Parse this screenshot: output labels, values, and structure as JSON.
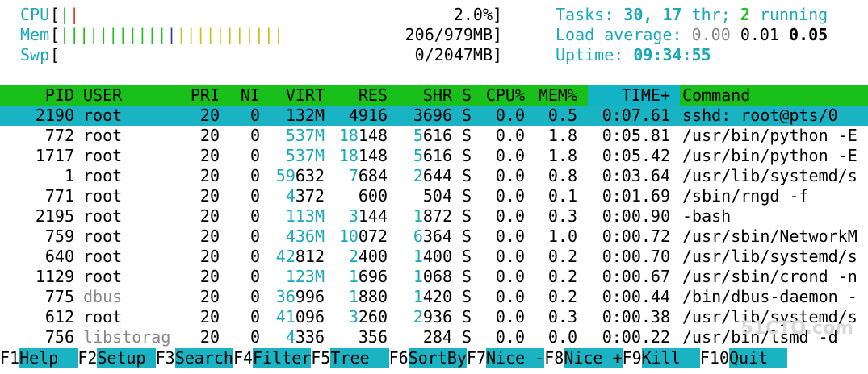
{
  "meters": {
    "cpu": {
      "label": "CPU",
      "value": "2.0%"
    },
    "mem": {
      "label": "Mem",
      "value": "206/979MB"
    },
    "swp": {
      "label": "Swp",
      "value": "0/2047MB"
    }
  },
  "summary": {
    "tasks_label": "Tasks:",
    "tasks_count": "30,",
    "threads": "17",
    "thr_label": "thr;",
    "running_count": "2",
    "running_label": "running",
    "load_label": "Load average:",
    "load1": "0.00",
    "load5": "0.01",
    "load15": "0.05",
    "uptime_label": "Uptime:",
    "uptime": "09:34:55"
  },
  "columns": {
    "pid": "PID",
    "user": "USER",
    "pri": "PRI",
    "ni": "NI",
    "virt": "VIRT",
    "res": "RES",
    "shr": "SHR",
    "s": "S",
    "cpu": "CPU%",
    "mem": "MEM%",
    "time": "TIME+",
    "command": "Command"
  },
  "processes": [
    {
      "pid": "2190",
      "user": "root",
      "pri": "20",
      "ni": "0",
      "virt": "132M",
      "res": "4916",
      "shr": "3696",
      "s": "S",
      "cpu": "0.0",
      "mem": "0.5",
      "time": "0:07.61",
      "command": "sshd: root@pts/0"
    },
    {
      "pid": "772",
      "user": "root",
      "pri": "20",
      "ni": "0",
      "virt": "537M",
      "res": "18148",
      "shr": "5616",
      "s": "S",
      "cpu": "0.0",
      "mem": "1.8",
      "time": "0:05.81",
      "command": "/usr/bin/python -E"
    },
    {
      "pid": "1717",
      "user": "root",
      "pri": "20",
      "ni": "0",
      "virt": "537M",
      "res": "18148",
      "shr": "5616",
      "s": "S",
      "cpu": "0.0",
      "mem": "1.8",
      "time": "0:05.42",
      "command": "/usr/bin/python -E"
    },
    {
      "pid": "1",
      "user": "root",
      "pri": "20",
      "ni": "0",
      "virt": "59632",
      "res": "7684",
      "shr": "2644",
      "s": "S",
      "cpu": "0.0",
      "mem": "0.8",
      "time": "0:03.64",
      "command": "/usr/lib/systemd/s"
    },
    {
      "pid": "771",
      "user": "root",
      "pri": "20",
      "ni": "0",
      "virt": "4372",
      "res": "600",
      "shr": "504",
      "s": "S",
      "cpu": "0.0",
      "mem": "0.1",
      "time": "0:01.69",
      "command": "/sbin/rngd -f"
    },
    {
      "pid": "2195",
      "user": "root",
      "pri": "20",
      "ni": "0",
      "virt": "113M",
      "res": "3144",
      "shr": "1872",
      "s": "S",
      "cpu": "0.0",
      "mem": "0.3",
      "time": "0:00.90",
      "command": "-bash"
    },
    {
      "pid": "759",
      "user": "root",
      "pri": "20",
      "ni": "0",
      "virt": "436M",
      "res": "10072",
      "shr": "6364",
      "s": "S",
      "cpu": "0.0",
      "mem": "1.0",
      "time": "0:00.72",
      "command": "/usr/sbin/NetworkM"
    },
    {
      "pid": "640",
      "user": "root",
      "pri": "20",
      "ni": "0",
      "virt": "42812",
      "res": "2400",
      "shr": "1400",
      "s": "S",
      "cpu": "0.0",
      "mem": "0.2",
      "time": "0:00.70",
      "command": "/usr/lib/systemd/s"
    },
    {
      "pid": "1129",
      "user": "root",
      "pri": "20",
      "ni": "0",
      "virt": "123M",
      "res": "1696",
      "shr": "1068",
      "s": "S",
      "cpu": "0.0",
      "mem": "0.2",
      "time": "0:00.67",
      "command": "/usr/sbin/crond -n"
    },
    {
      "pid": "775",
      "user": "dbus",
      "pri": "20",
      "ni": "0",
      "virt": "36996",
      "res": "1880",
      "shr": "1420",
      "s": "S",
      "cpu": "0.0",
      "mem": "0.2",
      "time": "0:00.44",
      "command": "/bin/dbus-daemon -"
    },
    {
      "pid": "612",
      "user": "root",
      "pri": "20",
      "ni": "0",
      "virt": "41096",
      "res": "3260",
      "shr": "2936",
      "s": "S",
      "cpu": "0.0",
      "mem": "0.3",
      "time": "0:00.38",
      "command": "/usr/lib/systemd/s"
    },
    {
      "pid": "756",
      "user": "libstorag",
      "pri": "20",
      "ni": "0",
      "virt": "4336",
      "res": "356",
      "shr": "284",
      "s": "S",
      "cpu": "0.0",
      "mem": "0.0",
      "time": "0:00.22",
      "command": "/usr/bin/lsmd -d"
    }
  ],
  "footer": [
    {
      "key": "F1",
      "label": "Help"
    },
    {
      "key": "F2",
      "label": "Setup"
    },
    {
      "key": "F3",
      "label": "Search"
    },
    {
      "key": "F4",
      "label": "Filter"
    },
    {
      "key": "F5",
      "label": "Tree"
    },
    {
      "key": "F6",
      "label": "SortBy"
    },
    {
      "key": "F7",
      "label": "Nice -"
    },
    {
      "key": "F8",
      "label": "Nice +"
    },
    {
      "key": "F9",
      "label": "Kill"
    },
    {
      "key": "F10",
      "label": "Quit"
    }
  ],
  "watermark": "51CTO.com"
}
